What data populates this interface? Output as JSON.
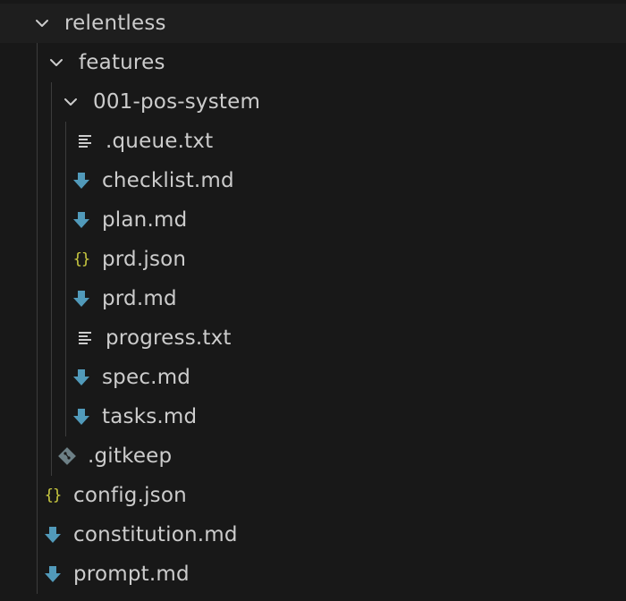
{
  "explorer": {
    "root": {
      "label": "relentless",
      "icon": "chevron-down-icon"
    },
    "features": {
      "label": "features",
      "icon": "chevron-down-icon"
    },
    "pos_system": {
      "label": "001-pos-system",
      "icon": "chevron-down-icon"
    },
    "files": [
      {
        "label": ".queue.txt",
        "icon": "text-lines-icon"
      },
      {
        "label": "checklist.md",
        "icon": "markdown-arrow-icon"
      },
      {
        "label": "plan.md",
        "icon": "markdown-arrow-icon"
      },
      {
        "label": "prd.json",
        "icon": "json-braces-icon"
      },
      {
        "label": "prd.md",
        "icon": "markdown-arrow-icon"
      },
      {
        "label": "progress.txt",
        "icon": "text-lines-icon"
      },
      {
        "label": "spec.md",
        "icon": "markdown-arrow-icon"
      },
      {
        "label": "tasks.md",
        "icon": "markdown-arrow-icon"
      }
    ],
    "gitkeep": {
      "label": ".gitkeep",
      "icon": "git-icon"
    },
    "root_files": [
      {
        "label": "config.json",
        "icon": "json-braces-icon"
      },
      {
        "label": "constitution.md",
        "icon": "markdown-arrow-icon"
      },
      {
        "label": "prompt.md",
        "icon": "markdown-arrow-icon"
      }
    ]
  },
  "colors": {
    "background": "#181818",
    "text": "#cccccc",
    "markdown_icon": "#519aba",
    "json_icon": "#cbcb41",
    "git_icon": "#6d8086"
  }
}
